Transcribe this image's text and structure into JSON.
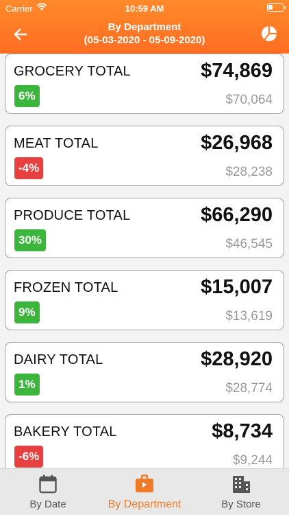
{
  "status_bar": {
    "carrier": "Carrier",
    "time": "10:59 AM"
  },
  "header": {
    "title": "By Department",
    "subtitle": "(05-03-2020 - 05-09-2020)",
    "back_icon": "arrow-left-icon",
    "chart_icon": "pie-chart-icon",
    "color": "#ff7a26"
  },
  "departments": [
    {
      "label": "GROCERY TOTAL",
      "value": "$74,869",
      "change": "6%",
      "previous": "$70,064",
      "trend": "up"
    },
    {
      "label": "MEAT TOTAL",
      "value": "$26,968",
      "change": "-4%",
      "previous": "$28,238",
      "trend": "down"
    },
    {
      "label": "PRODUCE TOTAL",
      "value": "$66,290",
      "change": "30%",
      "previous": "$46,545",
      "trend": "up"
    },
    {
      "label": "FROZEN TOTAL",
      "value": "$15,007",
      "change": "9%",
      "previous": "$13,619",
      "trend": "up"
    },
    {
      "label": "DAIRY TOTAL",
      "value": "$28,920",
      "change": "1%",
      "previous": "$28,774",
      "trend": "up"
    },
    {
      "label": "BAKERY TOTAL",
      "value": "$8,734",
      "change": "-6%",
      "previous": "$9,244",
      "trend": "down"
    }
  ],
  "tabs": [
    {
      "label": "By Date",
      "icon": "calendar-icon",
      "active": false
    },
    {
      "label": "By Department",
      "icon": "briefcase-icon",
      "active": true
    },
    {
      "label": "By Store",
      "icon": "building-icon",
      "active": false
    }
  ],
  "colors": {
    "positive": "#3bb53b",
    "negative": "#e74040",
    "accent": "#f07a28"
  }
}
